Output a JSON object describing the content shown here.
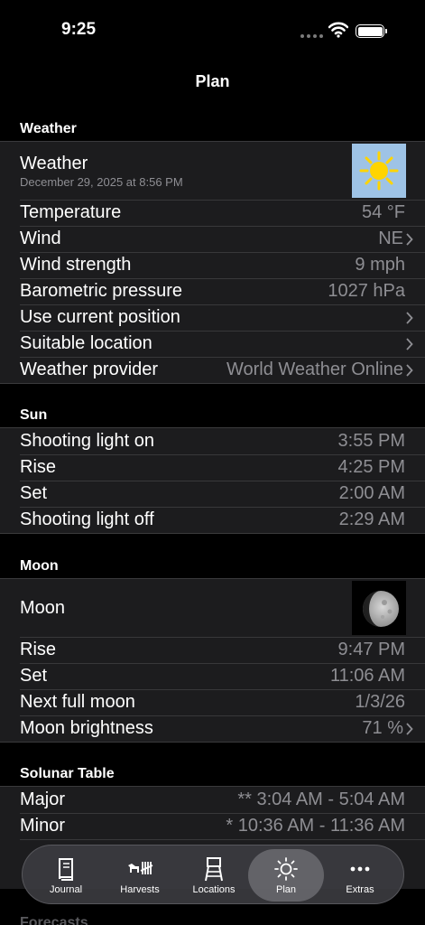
{
  "status": {
    "time": "9:25"
  },
  "nav": {
    "title": "Plan"
  },
  "weather": {
    "header": "Weather",
    "title": "Weather",
    "timestamp": "December 29, 2025 at 8:56 PM",
    "rows": [
      {
        "label": "Temperature",
        "value": "54 °F"
      },
      {
        "label": "Wind",
        "value": "NE"
      },
      {
        "label": "Wind strength",
        "value": "9 mph"
      },
      {
        "label": "Barometric pressure",
        "value": "1027 hPa"
      },
      {
        "label": "Use current position",
        "value": ""
      },
      {
        "label": "Suitable location",
        "value": ""
      },
      {
        "label": "Weather provider",
        "value": "World Weather Online"
      }
    ],
    "icon": "sun-icon"
  },
  "sun": {
    "header": "Sun",
    "rows": [
      {
        "label": "Shooting light on",
        "value": "3:55 PM"
      },
      {
        "label": "Rise",
        "value": "4:25 PM"
      },
      {
        "label": "Set",
        "value": "2:00 AM"
      },
      {
        "label": "Shooting light off",
        "value": "2:29 AM"
      }
    ]
  },
  "moon": {
    "header": "Moon",
    "title": "Moon",
    "rows": [
      {
        "label": "Rise",
        "value": "9:47 PM"
      },
      {
        "label": "Set",
        "value": "11:06 AM"
      },
      {
        "label": "Next full moon",
        "value": "1/3/26"
      },
      {
        "label": "Moon brightness",
        "value": "71 %"
      }
    ]
  },
  "solunar": {
    "header": "Solunar Table",
    "rows": [
      {
        "label": "Major",
        "value": "** 3:04 AM - 5:04 AM"
      },
      {
        "label": "Minor",
        "value": "* 10:36 AM - 11:36 AM"
      }
    ]
  },
  "forecasts": {
    "header": "Forecasts"
  },
  "tabs": [
    {
      "label": "Journal",
      "icon": "book-icon"
    },
    {
      "label": "Harvests",
      "icon": "deer-tally-icon"
    },
    {
      "label": "Locations",
      "icon": "hunting-stand-icon"
    },
    {
      "label": "Plan",
      "icon": "sun-icon"
    },
    {
      "label": "Extras",
      "icon": "more-icon"
    }
  ],
  "colors": {
    "background": "#000000",
    "cell": "#1c1c1e",
    "secondary_text": "#8e8e93",
    "sky_blue": "#9ec3e6",
    "sun_yellow": "#ffd400"
  }
}
